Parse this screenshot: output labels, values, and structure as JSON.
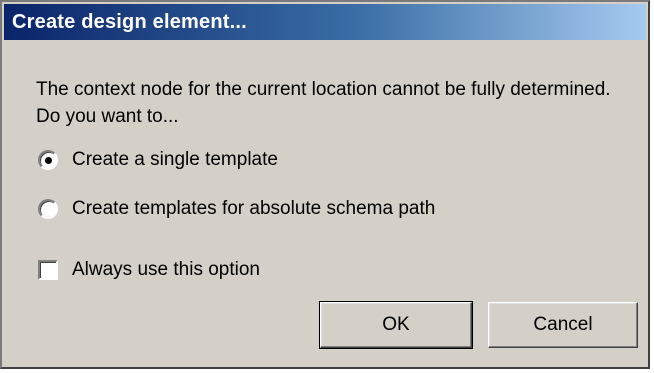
{
  "window": {
    "title": "Create design element..."
  },
  "dialog": {
    "prompt": "The context node for the current location cannot be fully determined. Do you want to...",
    "options": [
      {
        "label": "Create a single template",
        "selected": true
      },
      {
        "label": "Create templates for absolute schema path",
        "selected": false
      }
    ],
    "always_use": {
      "label": "Always use this option",
      "checked": false
    },
    "buttons": {
      "ok": "OK",
      "cancel": "Cancel"
    }
  }
}
